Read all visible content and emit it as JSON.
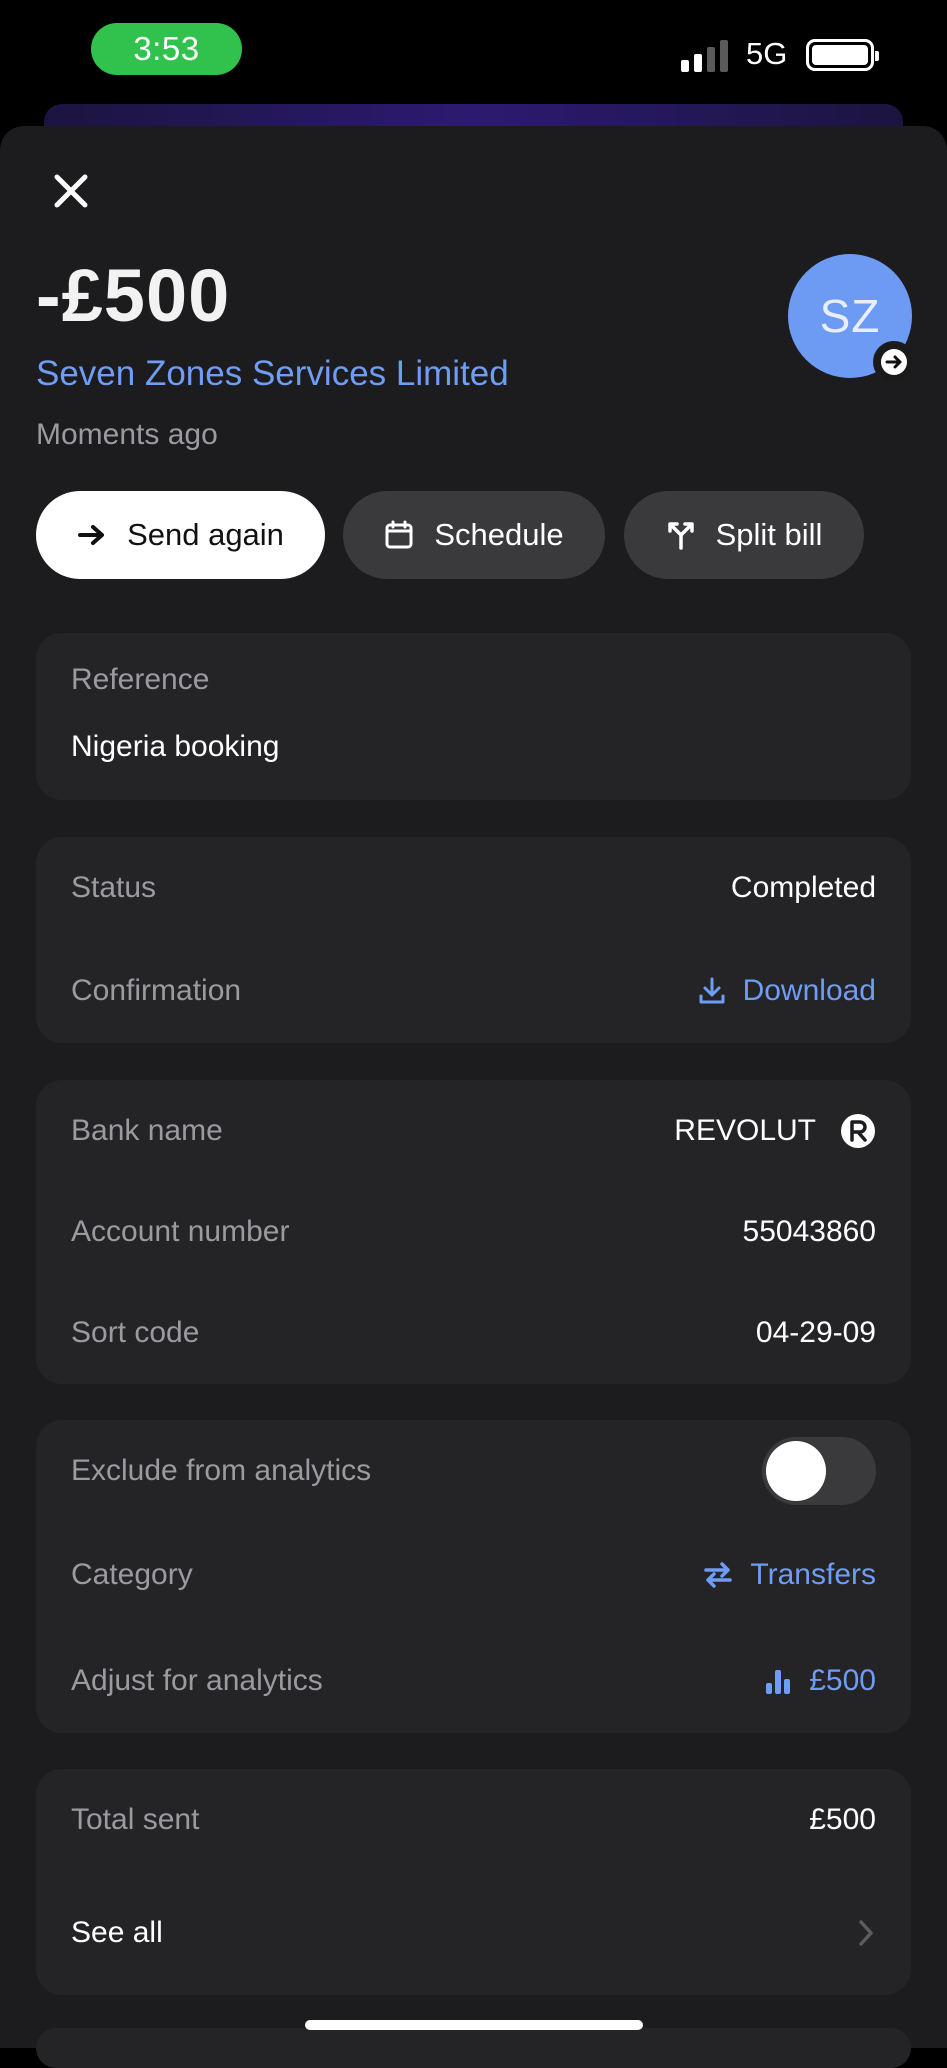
{
  "status_bar": {
    "time": "3:53",
    "network": "5G"
  },
  "header": {
    "amount": "-£500",
    "merchant": "Seven Zones Services Limited",
    "time_ago": "Moments ago",
    "avatar_initials": "SZ"
  },
  "actions": {
    "send_again": "Send again",
    "schedule": "Schedule",
    "split_bill": "Split bill"
  },
  "reference": {
    "label": "Reference",
    "value": "Nigeria booking"
  },
  "status_card": {
    "status_label": "Status",
    "status_value": "Completed",
    "confirmation_label": "Confirmation",
    "confirmation_value": "Download"
  },
  "bank_card": {
    "bank_label": "Bank name",
    "bank_value": "REVOLUT",
    "account_label": "Account number",
    "account_value": "55043860",
    "sort_label": "Sort code",
    "sort_value": "04-29-09"
  },
  "analytics_card": {
    "exclude_label": "Exclude from analytics",
    "exclude_on": false,
    "category_label": "Category",
    "category_value": "Transfers",
    "adjust_label": "Adjust for analytics",
    "adjust_value": "£500"
  },
  "totals_card": {
    "total_label": "Total sent",
    "total_value": "£500",
    "see_all_label": "See all"
  },
  "colors": {
    "accent": "#6f9cf4",
    "avatar": "#6d9af2",
    "time_pill": "#31c24d",
    "card": "#242426"
  }
}
